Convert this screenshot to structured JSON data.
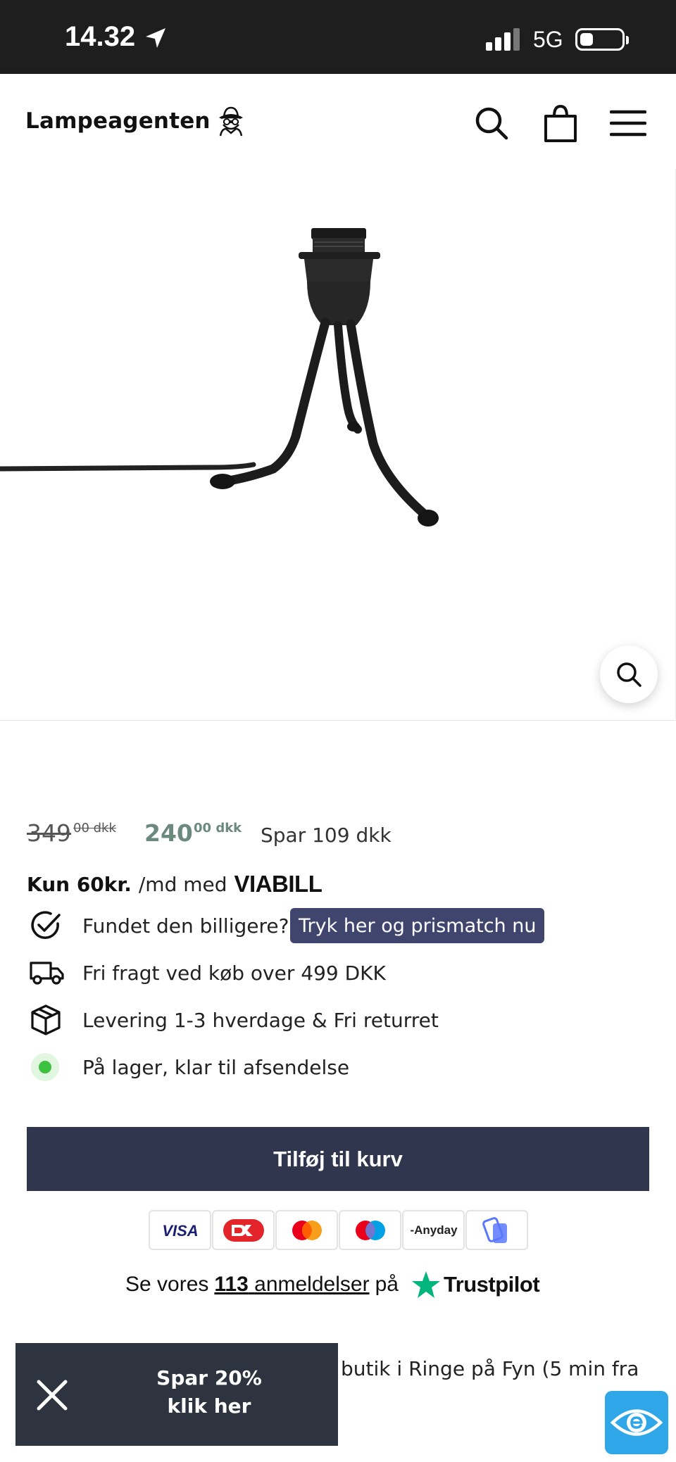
{
  "status_bar": {
    "time": "14.32",
    "network": "5G"
  },
  "header": {
    "logo_text": "Lampeagenten",
    "icons": [
      "search-icon",
      "cart-icon",
      "menu-icon"
    ]
  },
  "product": {
    "image_alt": "Tripod lamp base, black",
    "price": {
      "old_int": "349",
      "old_dec": "00 dkk",
      "new_int": "240",
      "new_dec": "00 dkk",
      "save": "Spar 109 dkk"
    },
    "viabill": {
      "amount": "Kun 60kr.",
      "middle": "/md med",
      "brand": "VIABILL"
    },
    "usps": {
      "price_match": "Fundet den billigere?",
      "price_match_button": "Tryk her og prismatch nu",
      "shipping": "Fri fragt ved køb over 499 DKK",
      "delivery": "Levering 1-3 hverdage & Fri returret",
      "stock": "På lager, klar til afsendelse"
    },
    "add_to_cart": "Tilføj til kurv"
  },
  "payments": [
    "VISA",
    "DK",
    "Mastercard",
    "Maestro",
    "Anyday",
    "MobilePay"
  ],
  "trustpilot": {
    "prefix": "Se vores",
    "count": "113",
    "reviews_word": "anmeldelser",
    "on": "på",
    "brand": "Trustpilot"
  },
  "description_partial": "butik i Ringe på Fyn (5 min fra",
  "promo": {
    "line1": "Spar 20%",
    "line2": "klik her"
  },
  "colors": {
    "cta": "#31364f",
    "match": "#40456e",
    "sale_price": "#6b8a7d",
    "trust_star": "#00b67a",
    "stock": "#3cc040"
  }
}
